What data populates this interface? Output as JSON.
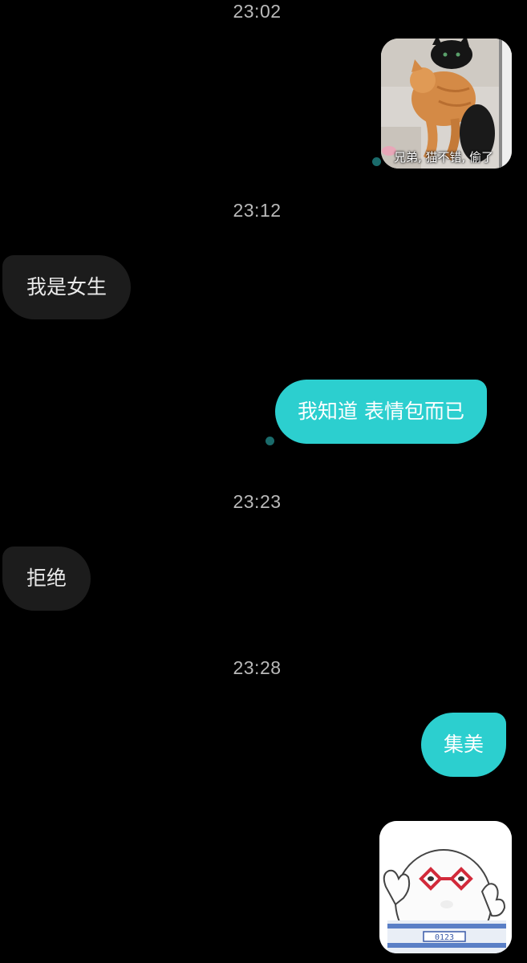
{
  "timestamps": [
    "23:02",
    "23:12",
    "23:23",
    "23:28"
  ],
  "messages": [
    {
      "side": "sent",
      "type": "image",
      "image": "cat-meme-image",
      "caption": "兄弟, 猫不错, 偷了"
    },
    {
      "side": "received",
      "type": "text",
      "text": "我是女生"
    },
    {
      "side": "sent",
      "type": "text",
      "text": "我知道 表情包而已"
    },
    {
      "side": "received",
      "type": "text",
      "text": "拒绝"
    },
    {
      "side": "sent",
      "type": "text",
      "text": "集美"
    },
    {
      "side": "sent",
      "type": "image",
      "image": "glasses-meme-image",
      "caption": "0123"
    }
  ],
  "colors": {
    "background": "#000000",
    "sent_bubble": "#2ccfcf",
    "received_bubble": "#1c1c1c",
    "timestamp_text": "#b9b9b9",
    "status_dot": "#1a6b6b"
  }
}
